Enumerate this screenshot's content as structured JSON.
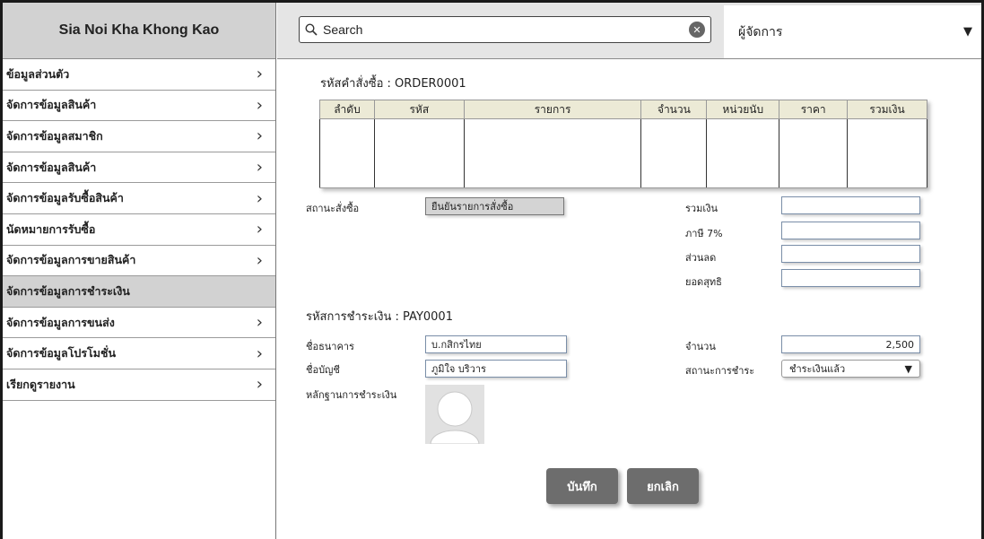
{
  "app": {
    "brand": "Sia Noi Kha Khong Kao"
  },
  "header": {
    "search_placeholder": "Search",
    "clear_glyph": "✕",
    "user_role": "ผู้จัดการ",
    "role_caret": "▼"
  },
  "sidebar": {
    "chevron": "›",
    "items": [
      {
        "label": "ข้อมูลส่วนตัว",
        "active": false
      },
      {
        "label": "จัดการข้อมูลสินค้า",
        "active": false
      },
      {
        "label": "จัดการข้อมูลสมาชิก",
        "active": false
      },
      {
        "label": "จัดการข้อมูลสินค้า",
        "active": false
      },
      {
        "label": "จัดการข้อมูลรับซื้อสินค้า",
        "active": false
      },
      {
        "label": "นัดหมายการรับซื้อ",
        "active": false
      },
      {
        "label": "จัดการข้อมูลการขายสินค้า",
        "active": false
      },
      {
        "label": "จัดการข้อมูลการชำระเงิน",
        "active": true
      },
      {
        "label": "จัดการข้อมูลการขนส่ง",
        "active": false
      },
      {
        "label": "จัดการข้อมูลโปรโมชั่น",
        "active": false
      },
      {
        "label": "เรียกดูรายงาน",
        "active": false
      }
    ]
  },
  "order": {
    "code_label": "รหัสคำสั่งซื้อ : ORDER0001",
    "table": {
      "columns": [
        "ลำดับ",
        "รหัส",
        "รายการ",
        "จำนวน",
        "หน่วยนับ",
        "ราคา",
        "รวมเงิน"
      ],
      "rows": []
    },
    "status_label": "สถานะสั่งซื้อ",
    "status_value": "ยืนยันรายการสั่งซื้อ",
    "totals": {
      "sum_label": "รวมเงิน",
      "vat_label": "ภาษี 7%",
      "discount_label": "ส่วนลด",
      "net_label": "ยอดสุทธิ",
      "sum_value": "",
      "vat_value": "",
      "discount_value": "",
      "net_value": ""
    }
  },
  "payment": {
    "code_label": "รหัสการชำระเงิน : PAY0001",
    "bank_label": "ชื่อธนาคาร",
    "bank_value": "บ.กสิกรไทย",
    "account_label": "ชื่อบัญชี",
    "account_value": "ภูมิใจ บริวาร",
    "evidence_label": "หลักฐานการชำระเงิน",
    "amount_label": "จำนวน",
    "amount_value": "2,500",
    "pay_status_label": "สถานะการชำระ",
    "pay_status_value": "ชำระเงินแล้ว",
    "pay_status_caret": "▼"
  },
  "actions": {
    "save": "บันทึก",
    "cancel": "ยกเลิก"
  },
  "colors": {
    "sidebar_active": "#d2d2d2",
    "table_header": "#ecead6",
    "button": "#6d6d6d"
  }
}
